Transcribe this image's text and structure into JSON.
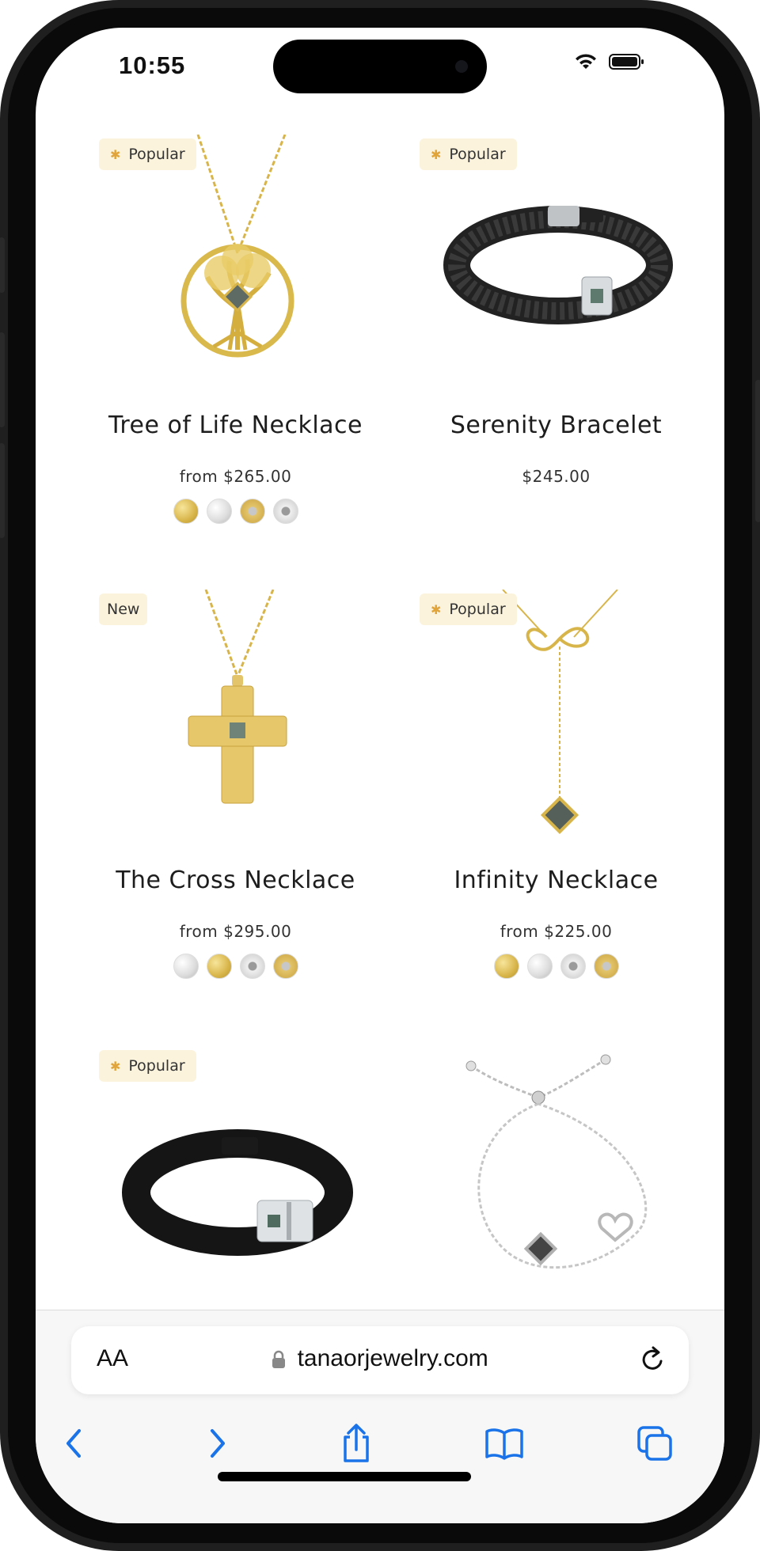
{
  "status_bar": {
    "time": "10:55"
  },
  "products": [
    {
      "name": "Tree of Life Necklace",
      "price": "from $265.00",
      "badge": "Popular",
      "badge_star": true,
      "swatches": [
        "gold",
        "silver",
        "gold-dot",
        "silver-dot"
      ],
      "image": "tree-of-life-necklace"
    },
    {
      "name": "Serenity Bracelet",
      "price": "$245.00",
      "badge": "Popular",
      "badge_star": true,
      "swatches": [],
      "image": "leather-braided-bracelet"
    },
    {
      "name": "The Cross Necklace",
      "price": "from $295.00",
      "badge": "New",
      "badge_star": false,
      "swatches": [
        "silver",
        "gold",
        "silver-dot",
        "gold-dot"
      ],
      "image": "cross-necklace"
    },
    {
      "name": "Infinity Necklace",
      "price": "from $225.00",
      "badge": "Popular",
      "badge_star": true,
      "swatches": [
        "gold",
        "silver",
        "silver-dot",
        "gold-dot"
      ],
      "image": "infinity-lariat-necklace"
    },
    {
      "name": "",
      "price": "",
      "badge": "Popular",
      "badge_star": true,
      "swatches": [],
      "image": "leather-band-bracelet"
    },
    {
      "name": "",
      "price": "",
      "badge": "",
      "badge_star": false,
      "swatches": [],
      "image": "silver-slider-bracelet"
    }
  ],
  "browser": {
    "text_size_label": "AA",
    "url": "tanaorjewelry.com",
    "nav": [
      "back-icon",
      "forward-icon",
      "share-icon",
      "bookmarks-icon",
      "tabs-icon"
    ]
  },
  "colors": {
    "badge_bg": "#fbf3dc",
    "star": "#e0a43a",
    "accent_blue": "#1a73e8"
  }
}
